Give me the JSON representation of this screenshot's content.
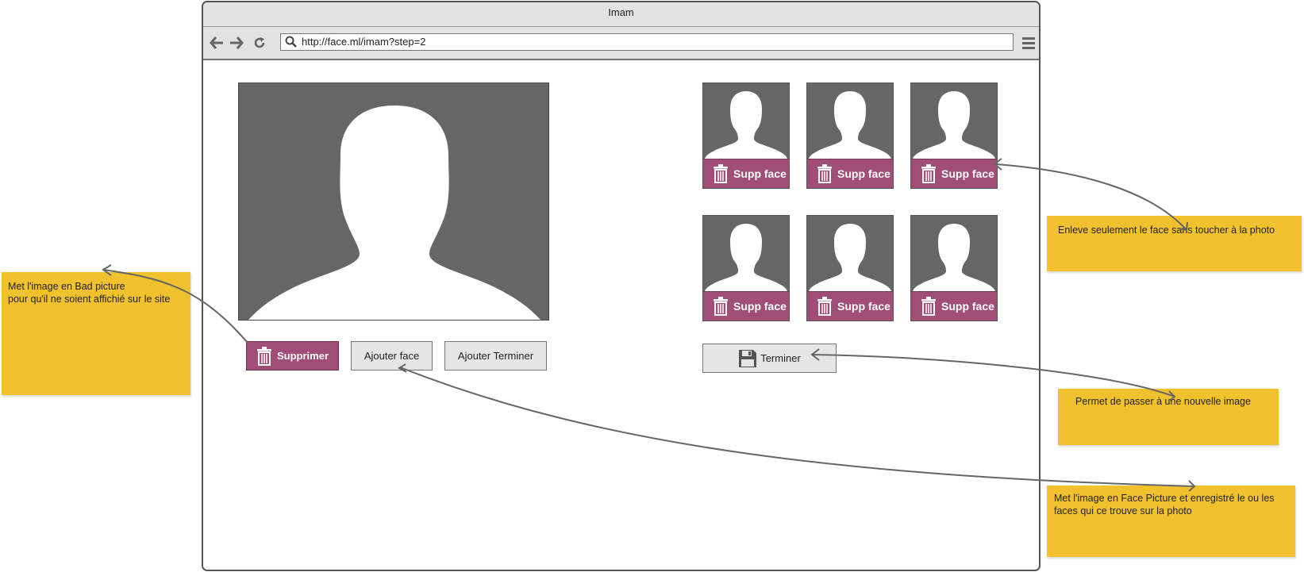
{
  "window": {
    "title": "Imam"
  },
  "toolbar": {
    "url": "http://face.ml/imam?step=2",
    "icons": [
      "back-arrow-icon",
      "forward-arrow-icon",
      "reload-icon",
      "search-icon",
      "hamburger-menu-icon"
    ]
  },
  "main": {
    "buttons": {
      "delete_label": "Supprimer",
      "add_face_label": "Ajouter face",
      "add_finish_label": "Ajouter Terminer"
    }
  },
  "faces": {
    "items": [
      {
        "label": "Supp face"
      },
      {
        "label": "Supp face"
      },
      {
        "label": "Supp face"
      },
      {
        "label": "Supp face"
      },
      {
        "label": "Supp face"
      },
      {
        "label": "Supp face"
      }
    ],
    "finish_label": "Terminer"
  },
  "notes": {
    "bad_picture_line1": "Met l'image  en Bad picture",
    "bad_picture_line2": "pour qu'il ne soient affichié sur le site",
    "remove_face": "Enleve seulement le face sans toucher à la photo",
    "next_image": "Permet de passer à une nouvelle image",
    "face_picture": "Met l'image en Face Picture et enregistré le ou les faces qui ce trouve sur la photo"
  },
  "colors": {
    "accent": "#a04e78",
    "note": "#f2c12e",
    "photo_bg": "#666666",
    "chrome": "#e3e3e3"
  }
}
